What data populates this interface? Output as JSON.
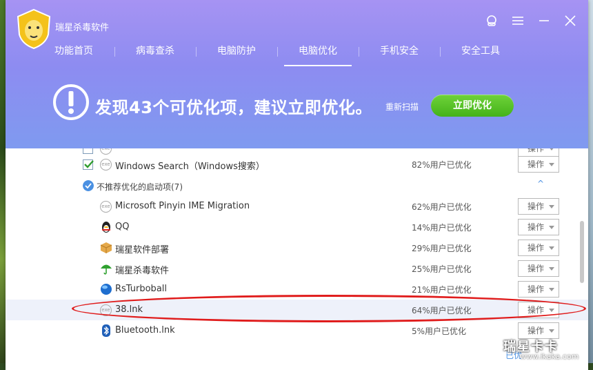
{
  "app": {
    "title": "瑞星杀毒软件"
  },
  "nav": [
    {
      "label": "功能首页"
    },
    {
      "label": "病毒查杀"
    },
    {
      "label": "电脑防护"
    },
    {
      "label": "电脑优化"
    },
    {
      "label": "手机安全"
    },
    {
      "label": "安全工具"
    }
  ],
  "banner": {
    "headline": "发现43个可优化项，建议立即优化。",
    "rescan": "重新扫描",
    "optimize": "立即优化"
  },
  "top_item": {
    "name": "Windows Search（Windows搜索）",
    "pct": "82%用户已优化",
    "op": "操作",
    "icon": "exe-icon"
  },
  "section": {
    "label": "不推荐优化的启动项(7)",
    "collapse": "^"
  },
  "items": [
    {
      "name": "Microsoft Pinyin IME Migration",
      "pct": "62%用户已优化",
      "op": "操作",
      "icon": "exe-icon"
    },
    {
      "name": "QQ",
      "pct": "14%用户已优化",
      "op": "操作",
      "icon": "qq-penguin-icon"
    },
    {
      "name": "瑞星软件部署",
      "pct": "29%用户已优化",
      "op": "操作",
      "icon": "package-box-icon"
    },
    {
      "name": "瑞星杀毒软件",
      "pct": "25%用户已优化",
      "op": "操作",
      "icon": "green-umbrella-icon"
    },
    {
      "name": "RsTurboball",
      "pct": "21%用户已优化",
      "op": "操作",
      "icon": "blue-ball-icon"
    },
    {
      "name": "38.lnk",
      "pct": "64%用户已优化",
      "op": "操作",
      "icon": "exe-icon"
    },
    {
      "name": "Bluetooth.lnk",
      "pct": "5%用户已优化",
      "op": "操作",
      "icon": "bluetooth-icon"
    }
  ],
  "footer": {
    "partial_link": "已优"
  },
  "watermark": {
    "big": "瑞星卡卡",
    "small": "www.ikaka.com"
  },
  "colors": {
    "accent": "#4a90e2",
    "header_top": "#a693f3",
    "header_bottom": "#7f9af0",
    "cta": "#44b21a",
    "annotation": "#e01c1c"
  }
}
